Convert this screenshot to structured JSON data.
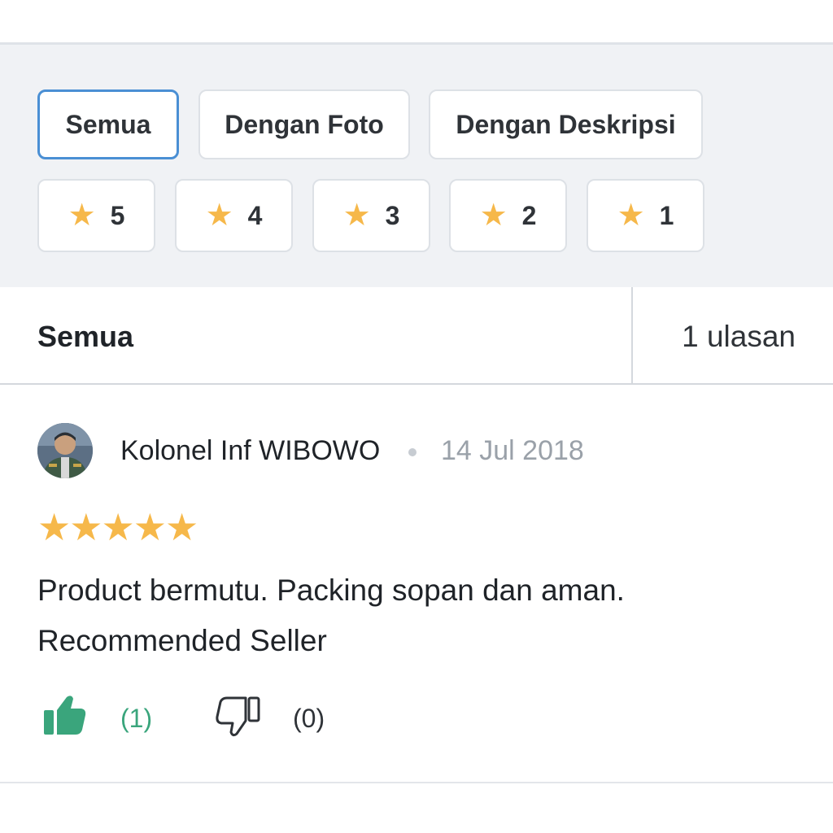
{
  "filters": {
    "type_chips": [
      {
        "label": "Semua",
        "active": true
      },
      {
        "label": "Dengan Foto",
        "active": false
      },
      {
        "label": "Dengan Deskripsi",
        "active": false
      }
    ],
    "rating_chips": [
      {
        "icon": "star-icon",
        "label": "5"
      },
      {
        "icon": "star-icon",
        "label": "4"
      },
      {
        "icon": "star-icon",
        "label": "3"
      },
      {
        "icon": "star-icon",
        "label": "2"
      },
      {
        "icon": "star-icon",
        "label": "1"
      }
    ]
  },
  "summary": {
    "title": "Semua",
    "count": "1 ulasan"
  },
  "reviews": [
    {
      "reviewer": "Kolonel Inf WIBOWO",
      "date": "14 Jul 2018",
      "rating": 5,
      "text_line1": "Product bermutu. Packing sopan dan aman.",
      "text_line2": "Recommended Seller",
      "helpful_count": "(1)",
      "not_helpful_count": "(0)"
    }
  ],
  "colors": {
    "accent": "#4a8fd4",
    "star": "#f6b84a",
    "like": "#3aa57c",
    "panel_bg": "#f0f2f5"
  }
}
